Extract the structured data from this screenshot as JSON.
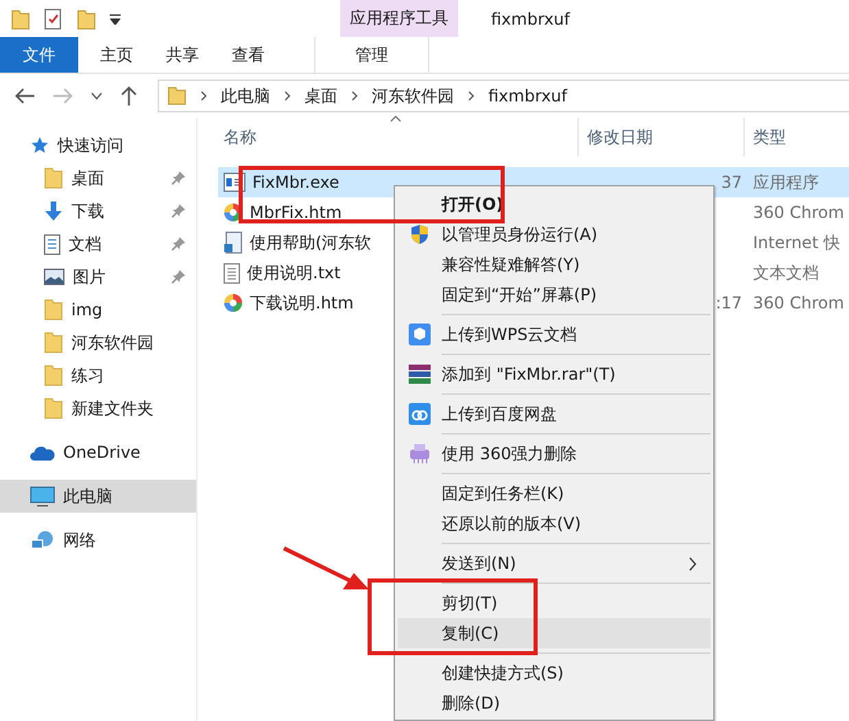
{
  "ribbon": {
    "context_group": "应用程序工具",
    "title": "fixmbrxuf",
    "tabs": [
      {
        "label": "文件",
        "kind": "file",
        "selected": false
      },
      {
        "label": "主页",
        "kind": "tab",
        "selected": false
      },
      {
        "label": "共享",
        "kind": "tab",
        "selected": false
      },
      {
        "label": "查看",
        "kind": "tab",
        "selected": false
      },
      {
        "label": "管理",
        "kind": "context",
        "selected": false
      }
    ]
  },
  "address_bar": {
    "path": [
      "此电脑",
      "桌面",
      "河东软件园",
      "fixmbrxuf"
    ]
  },
  "sidebar": {
    "items": [
      {
        "label": "快速访问",
        "kind": "star",
        "pinned": false,
        "selected": false,
        "children": [
          {
            "label": "桌面",
            "kind": "folder",
            "pinned": true,
            "selected": false
          },
          {
            "label": "下载",
            "kind": "download",
            "pinned": true,
            "selected": false
          },
          {
            "label": "文档",
            "kind": "document",
            "pinned": true,
            "selected": false
          },
          {
            "label": "图片",
            "kind": "picture",
            "pinned": true,
            "selected": false
          },
          {
            "label": "img",
            "kind": "folder",
            "pinned": false,
            "selected": false
          },
          {
            "label": "河东软件园",
            "kind": "folder",
            "pinned": false,
            "selected": false
          },
          {
            "label": "练习",
            "kind": "folder",
            "pinned": false,
            "selected": false
          },
          {
            "label": "新建文件夹",
            "kind": "folder",
            "pinned": false,
            "selected": false
          }
        ]
      },
      {
        "label": "OneDrive",
        "kind": "cloud",
        "pinned": false,
        "selected": false
      },
      {
        "label": "此电脑",
        "kind": "pc",
        "pinned": false,
        "selected": true
      },
      {
        "label": "网络",
        "kind": "network",
        "pinned": false,
        "selected": false
      }
    ]
  },
  "table": {
    "columns": [
      "名称",
      "修改日期",
      "类型"
    ],
    "rows": [
      {
        "name": "FixMbr.exe",
        "kind": "exe",
        "date": "37",
        "type": "应用程序",
        "selected": true
      },
      {
        "name": "MbrFix.htm",
        "kind": "htm",
        "type": "360 Chrom",
        "selected": false
      },
      {
        "name": "使用帮助(河东软",
        "kind": "url",
        "type": "Internet 快",
        "selected": false
      },
      {
        "name": "使用说明.txt",
        "kind": "txt",
        "type": "文本文档",
        "selected": false
      },
      {
        "name": "下载说明.htm",
        "kind": "htm",
        "date": ":17",
        "type": "360 Chrom",
        "selected": false
      }
    ]
  },
  "context_menu": {
    "items": [
      {
        "kind": "default",
        "label": "打开(O)",
        "selected": false
      },
      {
        "kind": "shield",
        "label": "以管理员身份运行(A)",
        "selected": false
      },
      {
        "kind": "item",
        "label": "兼容性疑难解答(Y)",
        "selected": false
      },
      {
        "kind": "item",
        "label": "固定到“开始”屏幕(P)",
        "selected": false
      },
      {
        "kind": "separator"
      },
      {
        "kind": "wps",
        "label": "上传到WPS云文档",
        "selected": false
      },
      {
        "kind": "separator"
      },
      {
        "kind": "rar",
        "label": "添加到 \"FixMbr.rar\"(T)",
        "selected": false
      },
      {
        "kind": "separator"
      },
      {
        "kind": "baidu",
        "label": "上传到百度网盘",
        "selected": false
      },
      {
        "kind": "separator"
      },
      {
        "kind": "shredder",
        "label": "使用 360强力删除",
        "selected": false
      },
      {
        "kind": "separator"
      },
      {
        "kind": "item",
        "label": "固定到任务栏(K)",
        "selected": false
      },
      {
        "kind": "item",
        "label": "还原以前的版本(V)",
        "selected": false
      },
      {
        "kind": "separator"
      },
      {
        "kind": "submenu",
        "label": "发送到(N)",
        "selected": false
      },
      {
        "kind": "separator"
      },
      {
        "kind": "item",
        "label": "剪切(T)",
        "selected": false
      },
      {
        "kind": "item",
        "label": "复制(C)",
        "selected": true
      },
      {
        "kind": "separator"
      },
      {
        "kind": "item",
        "label": "创建快捷方式(S)",
        "selected": false
      },
      {
        "kind": "item",
        "label": "删除(D)",
        "selected": false
      }
    ]
  }
}
